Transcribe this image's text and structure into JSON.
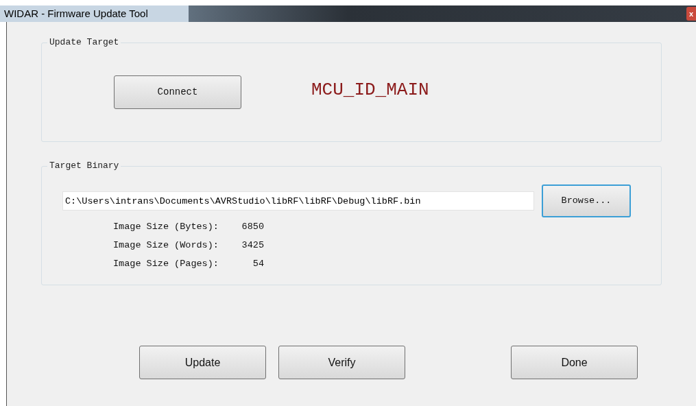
{
  "window": {
    "title": "WIDAR - Firmware Update Tool",
    "close": "x"
  },
  "update_target": {
    "label": "Update Target",
    "connect_button": {
      "label": "Connect",
      "focused": false
    },
    "target_id": "MCU_ID_MAIN"
  },
  "target_binary": {
    "label": "Target Binary",
    "path": "C:\\Users\\intrans\\Documents\\AVRStudio\\libRF\\libRF\\Debug\\libRF.bin",
    "browse_button": {
      "label": "Browse...",
      "focused": true
    },
    "stats": [
      {
        "label": "Image Size (Bytes):",
        "value": "6850"
      },
      {
        "label": "Image Size (Words):",
        "value": "3425"
      },
      {
        "label": "Image Size (Pages):",
        "value": "54"
      }
    ]
  },
  "buttons": [
    {
      "label": "Update",
      "focused": false
    },
    {
      "label": "Verify",
      "focused": false
    },
    {
      "label": "Done",
      "focused": false
    }
  ]
}
